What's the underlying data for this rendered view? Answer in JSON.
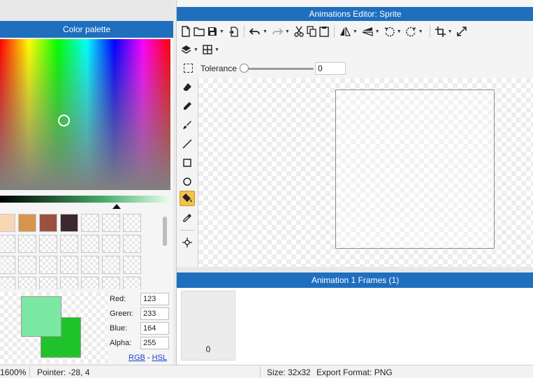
{
  "palette": {
    "title": "Color palette",
    "swatch_colors": [
      "#f8d7b4",
      "#d6944e",
      "#9a5142",
      "#3b2830"
    ],
    "empty_swatch_count": 24,
    "preview": {
      "primary": "#7be9a4",
      "secondary": "#1fc22a"
    },
    "fields": [
      {
        "label": "Red:",
        "value": "123"
      },
      {
        "label": "Green:",
        "value": "233"
      },
      {
        "label": "Blue:",
        "value": "164"
      },
      {
        "label": "Alpha:",
        "value": "255"
      }
    ],
    "modes": {
      "rgb": "RGB",
      "sep": "-",
      "hsl": "HSL"
    }
  },
  "editor": {
    "title": "Animations Editor: Sprite",
    "toolbar_icons": [
      "new-file",
      "open-folder",
      "save",
      "export",
      "undo",
      "redo",
      "cut",
      "copy",
      "paste",
      "flip-horizontal",
      "flip-vertical",
      "rotate-left",
      "rotate-right",
      "crop",
      "resize"
    ],
    "toolbar2_icons": [
      "layers",
      "grid"
    ],
    "tolerance": {
      "label": "Tolerance",
      "value": "0"
    },
    "tools": [
      "eraser",
      "pencil",
      "brush",
      "line",
      "rectangle",
      "ellipse",
      "fill-bucket",
      "eyedropper",
      "move-origin"
    ],
    "active_tool": "fill-bucket",
    "accent": "#1f6fbf",
    "active_color": "#f3c14a"
  },
  "frames": {
    "title": "Animation 1 Frames (1)",
    "items": [
      {
        "label": "0"
      }
    ]
  },
  "status": {
    "zoom": "1600%",
    "pointer": "Pointer: -28, 4",
    "size": "Size: 32x32",
    "export": "Export Format: PNG"
  }
}
